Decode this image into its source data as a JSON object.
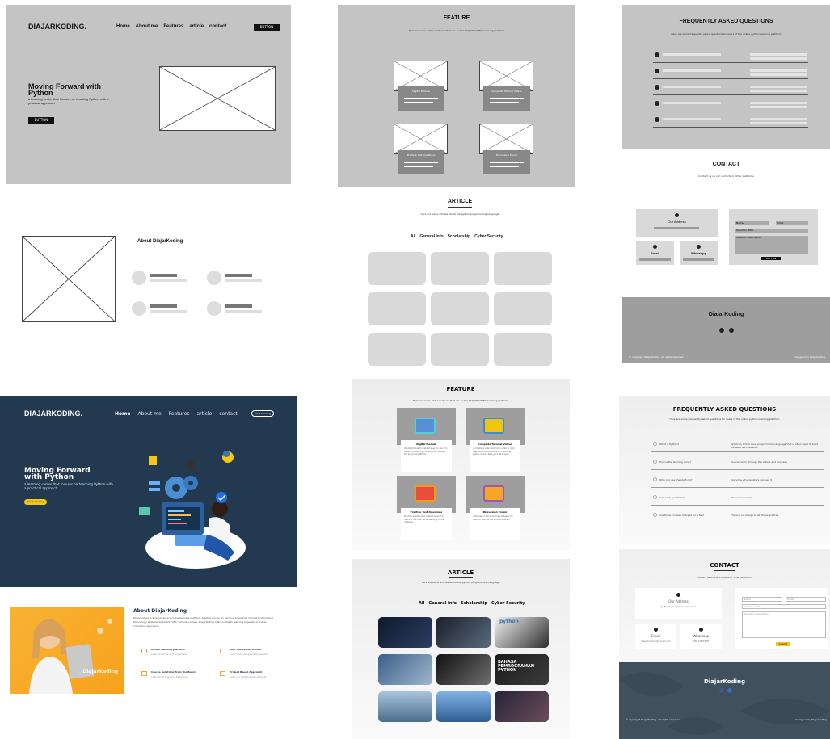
{
  "wf_hero": {
    "logo": "DIAJARKODING.",
    "nav": [
      "Home",
      "About me",
      "Features",
      "article",
      "contact"
    ],
    "button": "BUTTON",
    "title": "Moving Forward with Python",
    "subtitle": "a learning center that focuses on teaching Python with a practical approach",
    "cta": "BUTTON"
  },
  "wf_feature": {
    "title": "FEATURE",
    "subtitle": "Here are some of the features that are on the DIAJARKODING learning platform",
    "cards": [
      "Digital Module",
      "Complete Tutorial Videos",
      "Practice Test Questions",
      "Discussion Forum"
    ]
  },
  "wf_faq": {
    "title": "FREQUENTLY ASKED QUESTIONS",
    "subtitle": "Here are some frequently asked questions for users of the online python learning platform"
  },
  "wf_about": {
    "title": "About DiajarKoding"
  },
  "wf_article": {
    "title": "ARTICLE",
    "subtitle": "here are some articles about the python programming language",
    "tabs": [
      "All",
      "General Info",
      "Scholarship",
      "Cyber Security"
    ]
  },
  "wf_contact": {
    "title": "CONTACT",
    "subtitle": "Contact us on our contacts or other platforms",
    "address": "Our Address",
    "email": "Email",
    "whatsapp": "Whatsapp",
    "fields": [
      "Name",
      "Email",
      "Question Title",
      "Question description"
    ],
    "submit": "BUTTON"
  },
  "wf_footer": {
    "brand": "DiajarKoding",
    "copy": "© copyright DiajarKoding. All rights reserved",
    "credit": "Designed by Diajarkoding"
  },
  "hi_hero": {
    "logo": "DIAJARKODING.",
    "nav": [
      "Home",
      "About me",
      "Features",
      "article",
      "contact"
    ],
    "button": "Start learning",
    "title": "Moving Forward with Python",
    "subtitle": "a learning center that focuses on teaching Python with a practical approach",
    "cta": "Start learning"
  },
  "hi_feature": {
    "title": "FEATURE",
    "subtitle": "Here are some of the features that are on the DIAJARKODING learning platform",
    "cards": [
      {
        "name": "Digital Module",
        "desc": "Digital module to make it easy for users to study and learn python anytime through the provided platform."
      },
      {
        "name": "Complete Tutorial Videos",
        "desc": "a complete video tutorial in order to help users who are not familiar to learning python how to be a good developer."
      },
      {
        "name": "Practice Test Questions",
        "desc": "Practice questions to make it easier for users to test their understanding of the material."
      },
      {
        "name": "Discussion Forum",
        "desc": "a discussion forum to make it easier for users to discuss the problems faced."
      }
    ]
  },
  "hi_faq": {
    "title": "FREQUENTLY ASKED QUESTIONS",
    "subtitle": "Here are some frequently asked questions for users of the online python learning platform",
    "items": [
      {
        "q": "What is Python?",
        "a": "Python is a high-level programming language that is often used to build software and websites"
      },
      {
        "q": "How is the learning done?",
        "a": "You can learn through the videos and modules"
      },
      {
        "q": "Who can use the platform?",
        "a": "Everyone who registers can use it"
      },
      {
        "q": "Can I ask questions?",
        "a": "Of course you can"
      },
      {
        "q": "Are these courses charged for a fee?",
        "a": "There is no charge at all, these are free"
      }
    ]
  },
  "hi_about": {
    "title": "About DiajarKoding",
    "text": "DiajarKoding is a revolutionary online learning platform, leading you on an exciting adventure in programming and technology skills development. With various courses, DiajarKoding offers in-depth learning experience and an innovative approach.",
    "features": [
      {
        "name": "Online learning platform",
        "desc": "Learn anytime and anywhere"
      },
      {
        "name": "Best Choice curriculum",
        "desc": "Curriculum designed by experts"
      },
      {
        "name": "Course Solutions from the Basics",
        "desc": "Learn from the very beginning"
      },
      {
        "name": "Project Based Approach",
        "desc": "Learn by building real projects"
      }
    ],
    "badge": "DiajarKoding"
  },
  "hi_article": {
    "title": "ARTICLE",
    "subtitle": "here are some articles about the python programming language",
    "tabs": [
      "All",
      "General Info",
      "Scholarship",
      "Cyber Security"
    ],
    "book_text": "BAHASA PEMROGRAMAN PYTHON",
    "logo_text": "python"
  },
  "hi_contact": {
    "title": "CONTACT",
    "subtitle": "Contact us on our contacts or other platforms",
    "address": "Our Address",
    "address_val": "Jl. Example Street, Indonesia",
    "email": "Email",
    "email_val": "diajarkoding@gmail.com",
    "whatsapp": "Whatsapp",
    "wa_val": "0812345678",
    "fields": [
      "Name",
      "Email",
      "Question Title",
      "Question description"
    ],
    "submit": "Submit"
  },
  "hi_footer": {
    "brand": "DiajarKoding",
    "copy": "© copyright DiajarKoding. All rights reserved",
    "credit": "Designed by Diajarkoding"
  },
  "colors": {
    "wire_gray": "#c4c4c4",
    "navy": "#23394f",
    "accent": "#f5c518",
    "footer": "#40505d"
  }
}
